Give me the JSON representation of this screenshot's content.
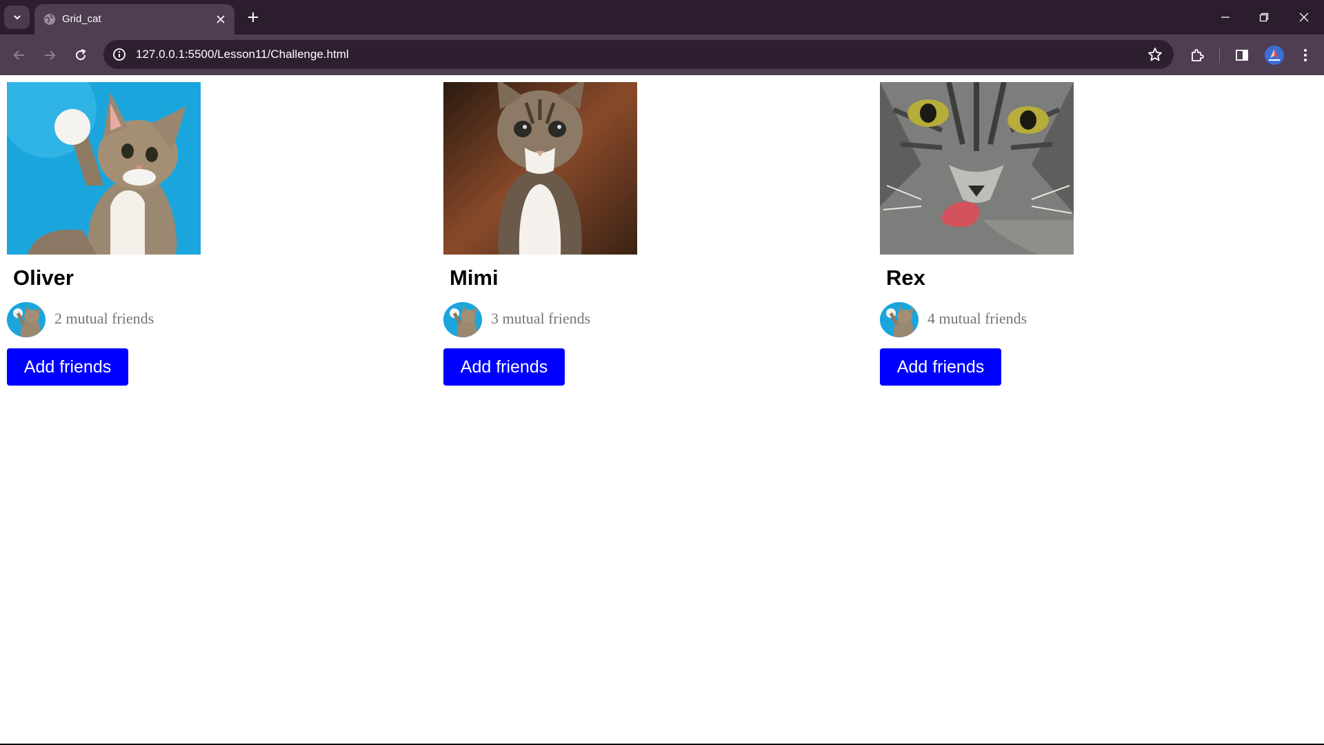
{
  "browser": {
    "tab_title": "Grid_cat",
    "url": "127.0.0.1:5500/Lesson11/Challenge.html",
    "icons": {
      "tab_search": "chevron-down-icon",
      "favicon": "globe-icon",
      "tab_close": "close-icon",
      "new_tab": "plus-icon",
      "minimize": "minimize-icon",
      "restore": "restore-icon",
      "close_window": "close-icon",
      "back": "arrow-left-icon",
      "forward": "arrow-right-icon",
      "reload": "reload-icon",
      "site_info": "info-icon",
      "bookmark": "star-icon",
      "extensions": "puzzle-icon",
      "side_panel": "side-panel-icon",
      "menu": "kebab-icon"
    },
    "colors": {
      "tabbar": "#2b1c2e",
      "toolbar": "#4f3d52",
      "omnibox": "#2d1f30"
    }
  },
  "cards": [
    {
      "name": "Oliver",
      "mutual": "2 mutual friends",
      "button": "Add friends"
    },
    {
      "name": "Mimi",
      "mutual": "3 mutual friends",
      "button": "Add friends"
    },
    {
      "name": "Rex",
      "mutual": "4 mutual friends",
      "button": "Add friends"
    }
  ],
  "colors": {
    "button_bg": "#0000ff",
    "button_text": "#ffffff",
    "mutual_text": "#757575"
  }
}
